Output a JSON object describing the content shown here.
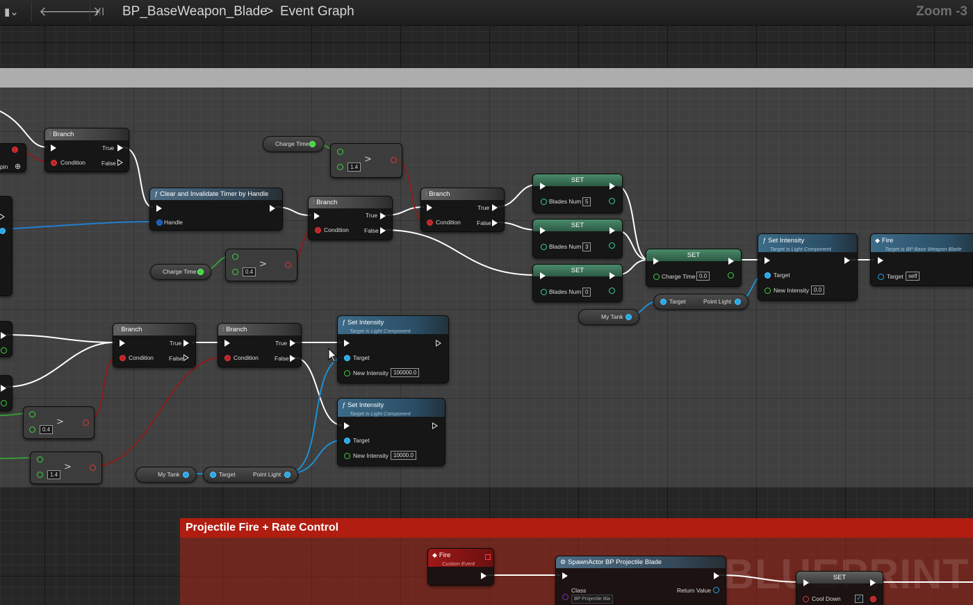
{
  "toolbar": {
    "bookmark_icon": "bookmark-icon",
    "breadcrumb_blueprint": "BP_BaseWeapon_Blade",
    "breadcrumb_separator": ">",
    "breadcrumb_graph": "Event Graph",
    "zoom": "Zoom -3"
  },
  "comments": {
    "fire_rate_title": "Projectile Fire + Rate Control"
  },
  "watermark": "BLUEPRINT",
  "nodes": {
    "branch": "Branch",
    "true": "True",
    "false": "False",
    "condition": "Condition",
    "add_pin": "pin",
    "clear_timer": "Clear and Invalidate Timer by Handle",
    "handle": "Handle",
    "charge_time": "Charge Time",
    "val_14": "1.4",
    "val_04": "0.4",
    "set": "SET",
    "blades_num": "Blades Num",
    "blades_5": "5",
    "blades_3": "3",
    "blades_0": "0",
    "charge_zero": "0.0",
    "set_intensity": "Set Intensity",
    "target_is_light": "Target is Light Component",
    "target": "Target",
    "new_intensity": "New Intensity",
    "intensity_zero": "0.0",
    "intensity_high": "100000.0",
    "intensity_mid": "10000.0",
    "fire": "Fire",
    "target_is_bp": "Target is BP Base Weapon Blade",
    "self": "self",
    "my_tank": "My Tank",
    "point_light": "Point Light",
    "custom_event": "Custom Event",
    "spawn_actor": "SpawnActor BP Projectile Blade",
    "class": "Class",
    "class_value": "BP Projectile Bla",
    "return_value": "Return Value",
    "cool_down": "Cool Down"
  },
  "colors": {
    "exec_wire": "#ffffff",
    "bool_wire": "#8a1a1a",
    "float_wire": "#3a8a3a",
    "object_wire": "#1f8fd0",
    "comment_red": "#b11d10"
  }
}
